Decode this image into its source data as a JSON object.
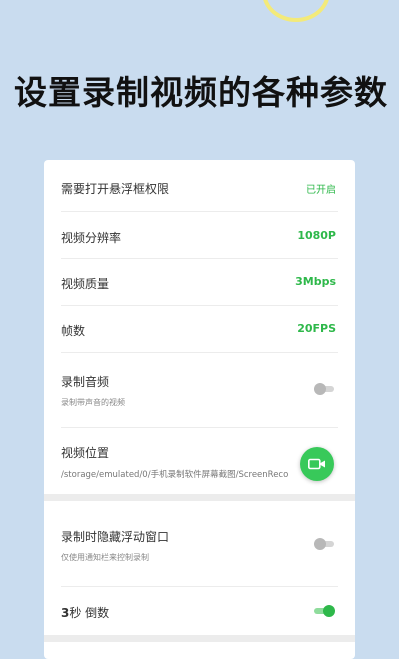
{
  "headline": "设置录制视频的各种参数",
  "settings": {
    "overlay_permission": {
      "label": "需要打开悬浮框权限",
      "value": "已开启"
    },
    "resolution": {
      "label": "视频分辨率",
      "value": "1080P"
    },
    "quality": {
      "label": "视频质量",
      "value": "3Mbps"
    },
    "fps": {
      "label": "帧数",
      "value": "20FPS"
    },
    "record_audio": {
      "label": "录制音频",
      "sub": "录制带声音的视频",
      "enabled": false
    },
    "video_location": {
      "label": "视频位置",
      "path": "/storage/emulated/0/手机录制软件屏幕截图/ScreenReco"
    },
    "hide_float": {
      "label": "录制时隐藏浮动窗口",
      "sub": "仅使用通知栏来控制录制",
      "enabled": false
    },
    "countdown": {
      "seconds": "3",
      "label": "秒 倒数",
      "enabled": true
    }
  },
  "colors": {
    "accent": "#2eb84a",
    "background": "#c9dcef"
  },
  "icons": {
    "fab": "video-camera-icon"
  }
}
